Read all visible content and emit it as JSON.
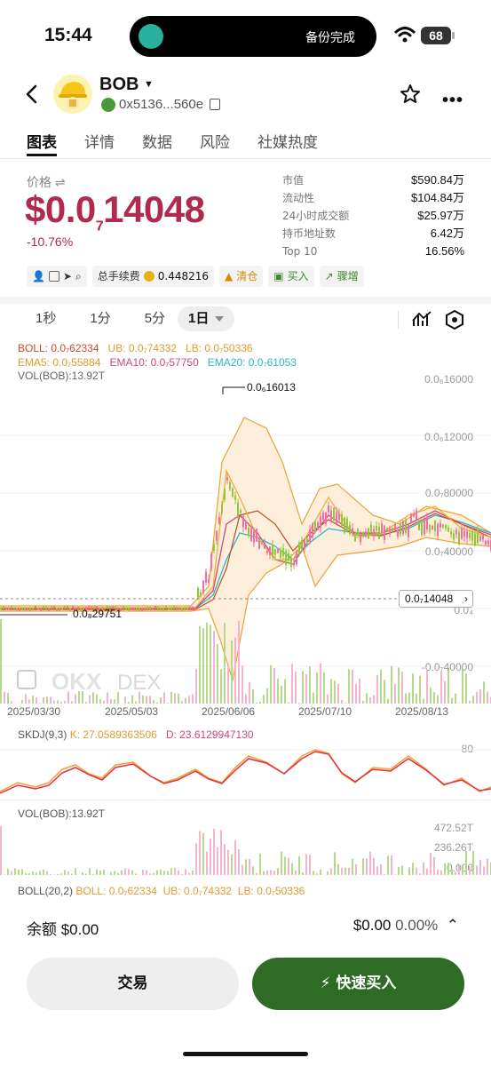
{
  "status": {
    "time": "15:44",
    "island_text": "备份完成",
    "battery": "68"
  },
  "header": {
    "token": "BOB",
    "address": "0x5136...560e"
  },
  "tabs": [
    "图表",
    "详情",
    "数据",
    "风险",
    "社媒热度"
  ],
  "price": {
    "label": "价格",
    "main_prefix": "$0.0",
    "sub_zero": "7",
    "main_suffix": "14048",
    "change": "-10.76%"
  },
  "stats": [
    {
      "k": "市值",
      "v": "$590.84万"
    },
    {
      "k": "流动性",
      "v": "$104.84万"
    },
    {
      "k": "24小时成交额",
      "v": "$25.97万"
    },
    {
      "k": "持币地址数",
      "v": "6.42万"
    },
    {
      "k": "Top 10",
      "v": "16.56%"
    }
  ],
  "chips": {
    "fee_label": "总手续费",
    "fee_value": "0.448216",
    "clear": "清仓",
    "buy": "买入",
    "surge": "骤增"
  },
  "timeframes": [
    "1秒",
    "1分",
    "5分"
  ],
  "timeframe_active": "1日",
  "legend": {
    "boll": "BOLL: 0.0₇62334",
    "ub": "UB: 0.0₇74332",
    "lb": "LB: 0.0₇50336",
    "ema5": "EMA5: 0.0₇55884",
    "ema10": "EMA10: 0.0₇57750",
    "ema20": "EMA20: 0.0₇61053",
    "vol": "VOL(BOB):13.92T"
  },
  "yaxis": [
    "0.0₆16000",
    "0.0₆12000",
    "0.0₇80000",
    "0.0₇40000",
    "0.0₄",
    "-0.0₇40000"
  ],
  "peak_label": "0.0₆16013",
  "low_label": "0.0₈29751",
  "current_price_tag": "0.0₇14048",
  "dates": [
    "2025/03/30",
    "2025/05/03",
    "2025/06/06",
    "2025/07/10",
    "2025/08/13"
  ],
  "skdj": {
    "label": "SKDJ(9,3)",
    "k": "K: 27.0589363506",
    "d": "D: 23.6129947130",
    "level": "80"
  },
  "vol2": {
    "label": "VOL(BOB):13.92T",
    "ticks": [
      "472.52T",
      "236.26T",
      "0.000"
    ]
  },
  "boll2": {
    "label": "BOLL(20,2)",
    "boll": "BOLL: 0.0₇62334",
    "ub": "UB: 0.0₇74332",
    "lb": "LB: 0.0₇50336"
  },
  "watermark": "DEX",
  "bottom": {
    "balance": "余额 $0.00",
    "right_amount": "$0.00",
    "right_pct": "0.00%",
    "trade": "交易",
    "quick_buy": "快速买入"
  }
}
